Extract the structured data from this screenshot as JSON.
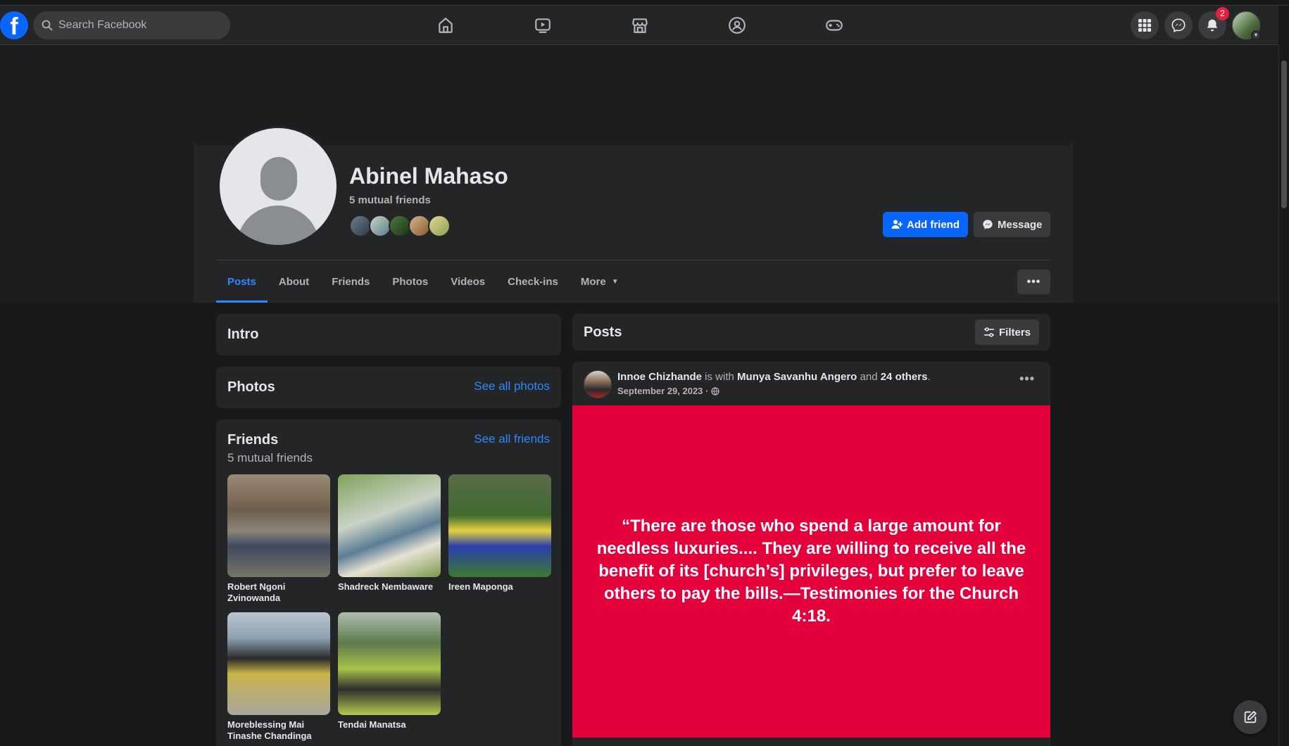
{
  "header": {
    "search_placeholder": "Search Facebook",
    "notifications_count": "2",
    "nav": [
      "home-icon",
      "watch-icon",
      "marketplace-icon",
      "groups-icon",
      "gaming-icon"
    ]
  },
  "profile": {
    "name": "Abinel Mahaso",
    "mutual_friends": "5 mutual friends",
    "add_friend_label": "Add friend",
    "message_label": "Message"
  },
  "tabs": [
    {
      "label": "Posts",
      "active": true
    },
    {
      "label": "About"
    },
    {
      "label": "Friends"
    },
    {
      "label": "Photos"
    },
    {
      "label": "Videos"
    },
    {
      "label": "Check-ins"
    },
    {
      "label": "More"
    }
  ],
  "intro": {
    "title": "Intro"
  },
  "photos": {
    "title": "Photos",
    "link": "See all photos"
  },
  "friends": {
    "title": "Friends",
    "link": "See all friends",
    "subtitle": "5 mutual friends",
    "items": [
      {
        "name": "Robert Ngoni Zvinowanda"
      },
      {
        "name": "Shadreck Nembaware"
      },
      {
        "name": "Ireen Maponga"
      },
      {
        "name": "Moreblessing Mai Tinashe Chandinga"
      },
      {
        "name": "Tendai Manatsa"
      }
    ]
  },
  "posts": {
    "title": "Posts",
    "filters_label": "Filters",
    "post": {
      "author": "Innoe Chizhande",
      "is_with": "is with",
      "with_name": "Munya Savanhu Angero",
      "and": "and",
      "others": "24 others",
      "date": "September 29, 2023 ·",
      "quote": "“There are those who spend a large amount for needless luxuries.... They are willing to receive all the benefit of its [church’s] privileges, but prefer to leave others to pay the bills.—Testimonies for the Church 4:18."
    }
  },
  "colors": {
    "accent": "#0866ff",
    "link": "#2d88ff",
    "quote_bg": "#e4003b",
    "badge": "#e41e3f"
  }
}
